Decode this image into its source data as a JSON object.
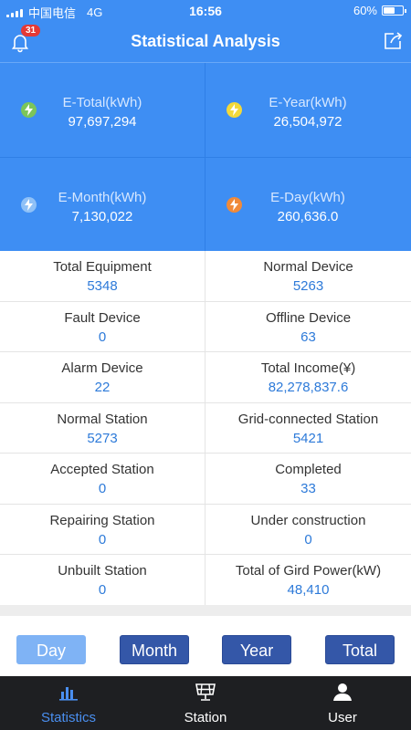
{
  "status": {
    "carrier": "中国电信",
    "network": "4G",
    "time": "16:56",
    "battery": "60%",
    "battery_level": 0.6
  },
  "header": {
    "title": "Statistical Analysis",
    "notification_count": "31"
  },
  "energy": [
    {
      "label": "E-Total(kWh)",
      "value": "97,697,294",
      "color": "#7cc55a"
    },
    {
      "label": "E-Year(kWh)",
      "value": "26,504,972",
      "color": "#f3d93a"
    },
    {
      "label": "E-Month(kWh)",
      "value": "7,130,022",
      "color": "#8fc1f7"
    },
    {
      "label": "E-Day(kWh)",
      "value": "260,636.0",
      "color": "#f08a3a"
    }
  ],
  "stats": [
    {
      "label": "Total Equipment",
      "value": "5348"
    },
    {
      "label": "Normal Device",
      "value": "5263"
    },
    {
      "label": "Fault Device",
      "value": "0"
    },
    {
      "label": "Offline Device",
      "value": "63"
    },
    {
      "label": "Alarm Device",
      "value": "22"
    },
    {
      "label": "Total Income(¥)",
      "value": "82,278,837.6"
    },
    {
      "label": "Normal Station",
      "value": "5273"
    },
    {
      "label": "Grid-connected Station",
      "value": "5421"
    },
    {
      "label": "Accepted Station",
      "value": "0"
    },
    {
      "label": "Completed",
      "value": "33"
    },
    {
      "label": "Repairing Station",
      "value": "0"
    },
    {
      "label": "Under construction",
      "value": "0"
    },
    {
      "label": "Unbuilt Station",
      "value": "0"
    },
    {
      "label": "Total of Gird Power(kW)",
      "value": "48,410"
    }
  ],
  "periods": {
    "day": "Day",
    "month": "Month",
    "year": "Year",
    "total": "Total",
    "selected": "day"
  },
  "tabs": {
    "statistics": "Statistics",
    "station": "Station",
    "user": "User",
    "active": "statistics"
  },
  "colors": {
    "header_bg": "#3e8ef3",
    "value_text": "#2d7ad9",
    "tab_active": "#4a8ff0",
    "tabbar_bg": "#1e1f22"
  }
}
